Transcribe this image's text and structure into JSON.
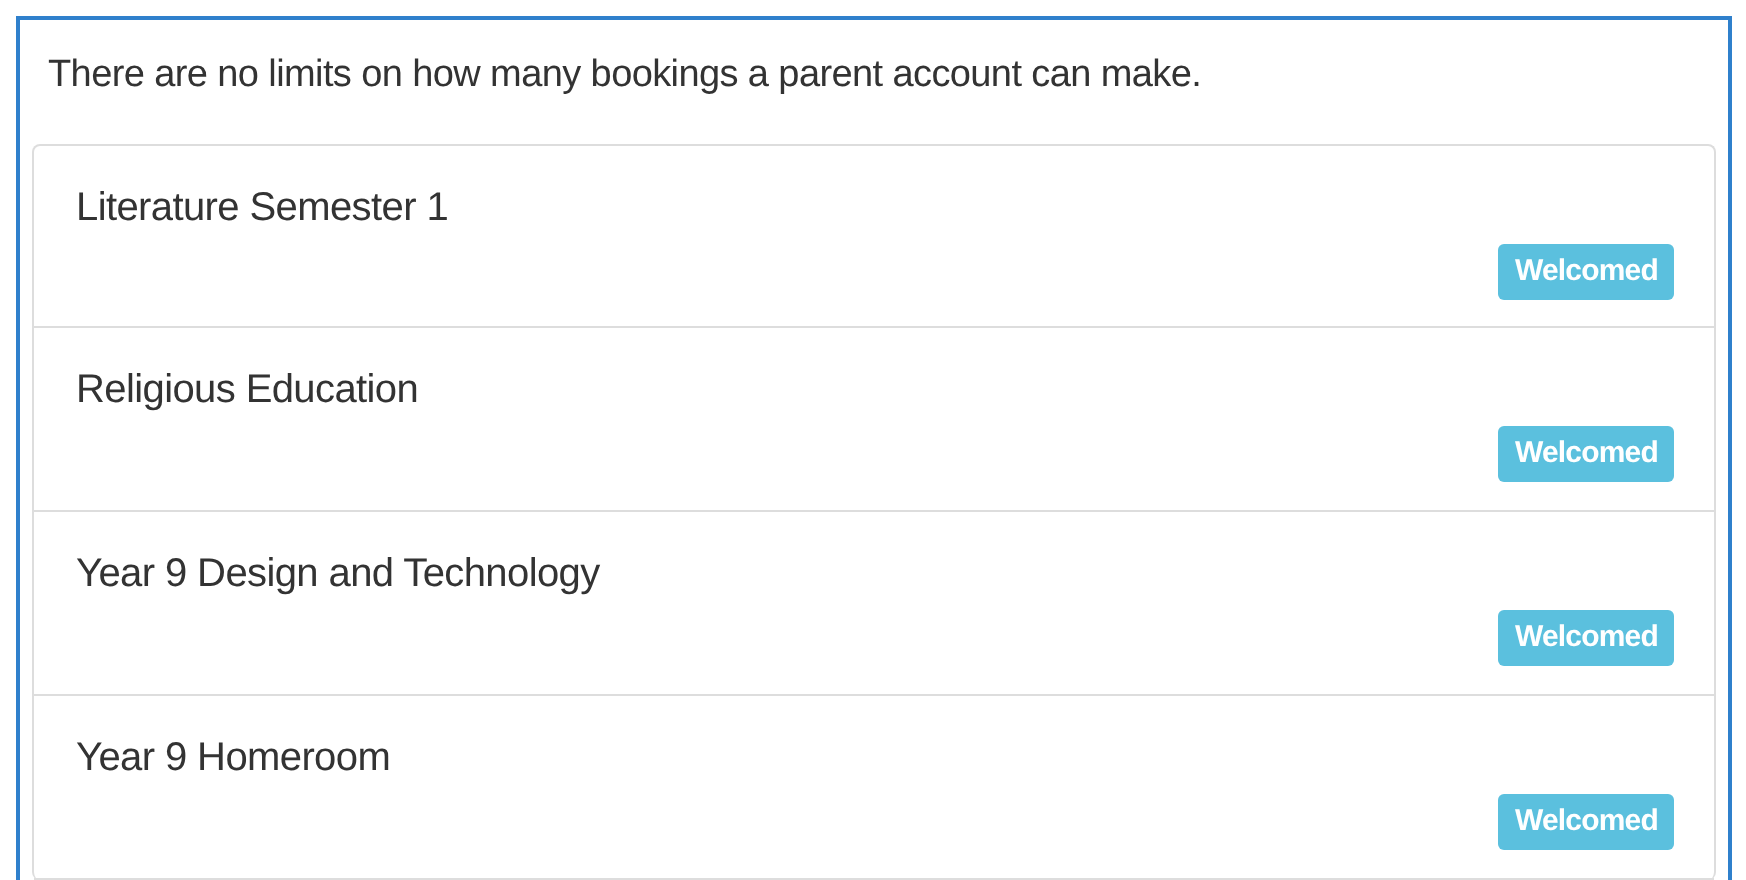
{
  "notice": "There are no limits on how many bookings a parent account can make.",
  "bookings": [
    {
      "title": "Literature Semester 1",
      "status": "Welcomed"
    },
    {
      "title": "Religious Education",
      "status": "Welcomed"
    },
    {
      "title": "Year 9 Design and Technology",
      "status": "Welcomed"
    },
    {
      "title": "Year 9 Homeroom",
      "status": "Welcomed"
    }
  ]
}
